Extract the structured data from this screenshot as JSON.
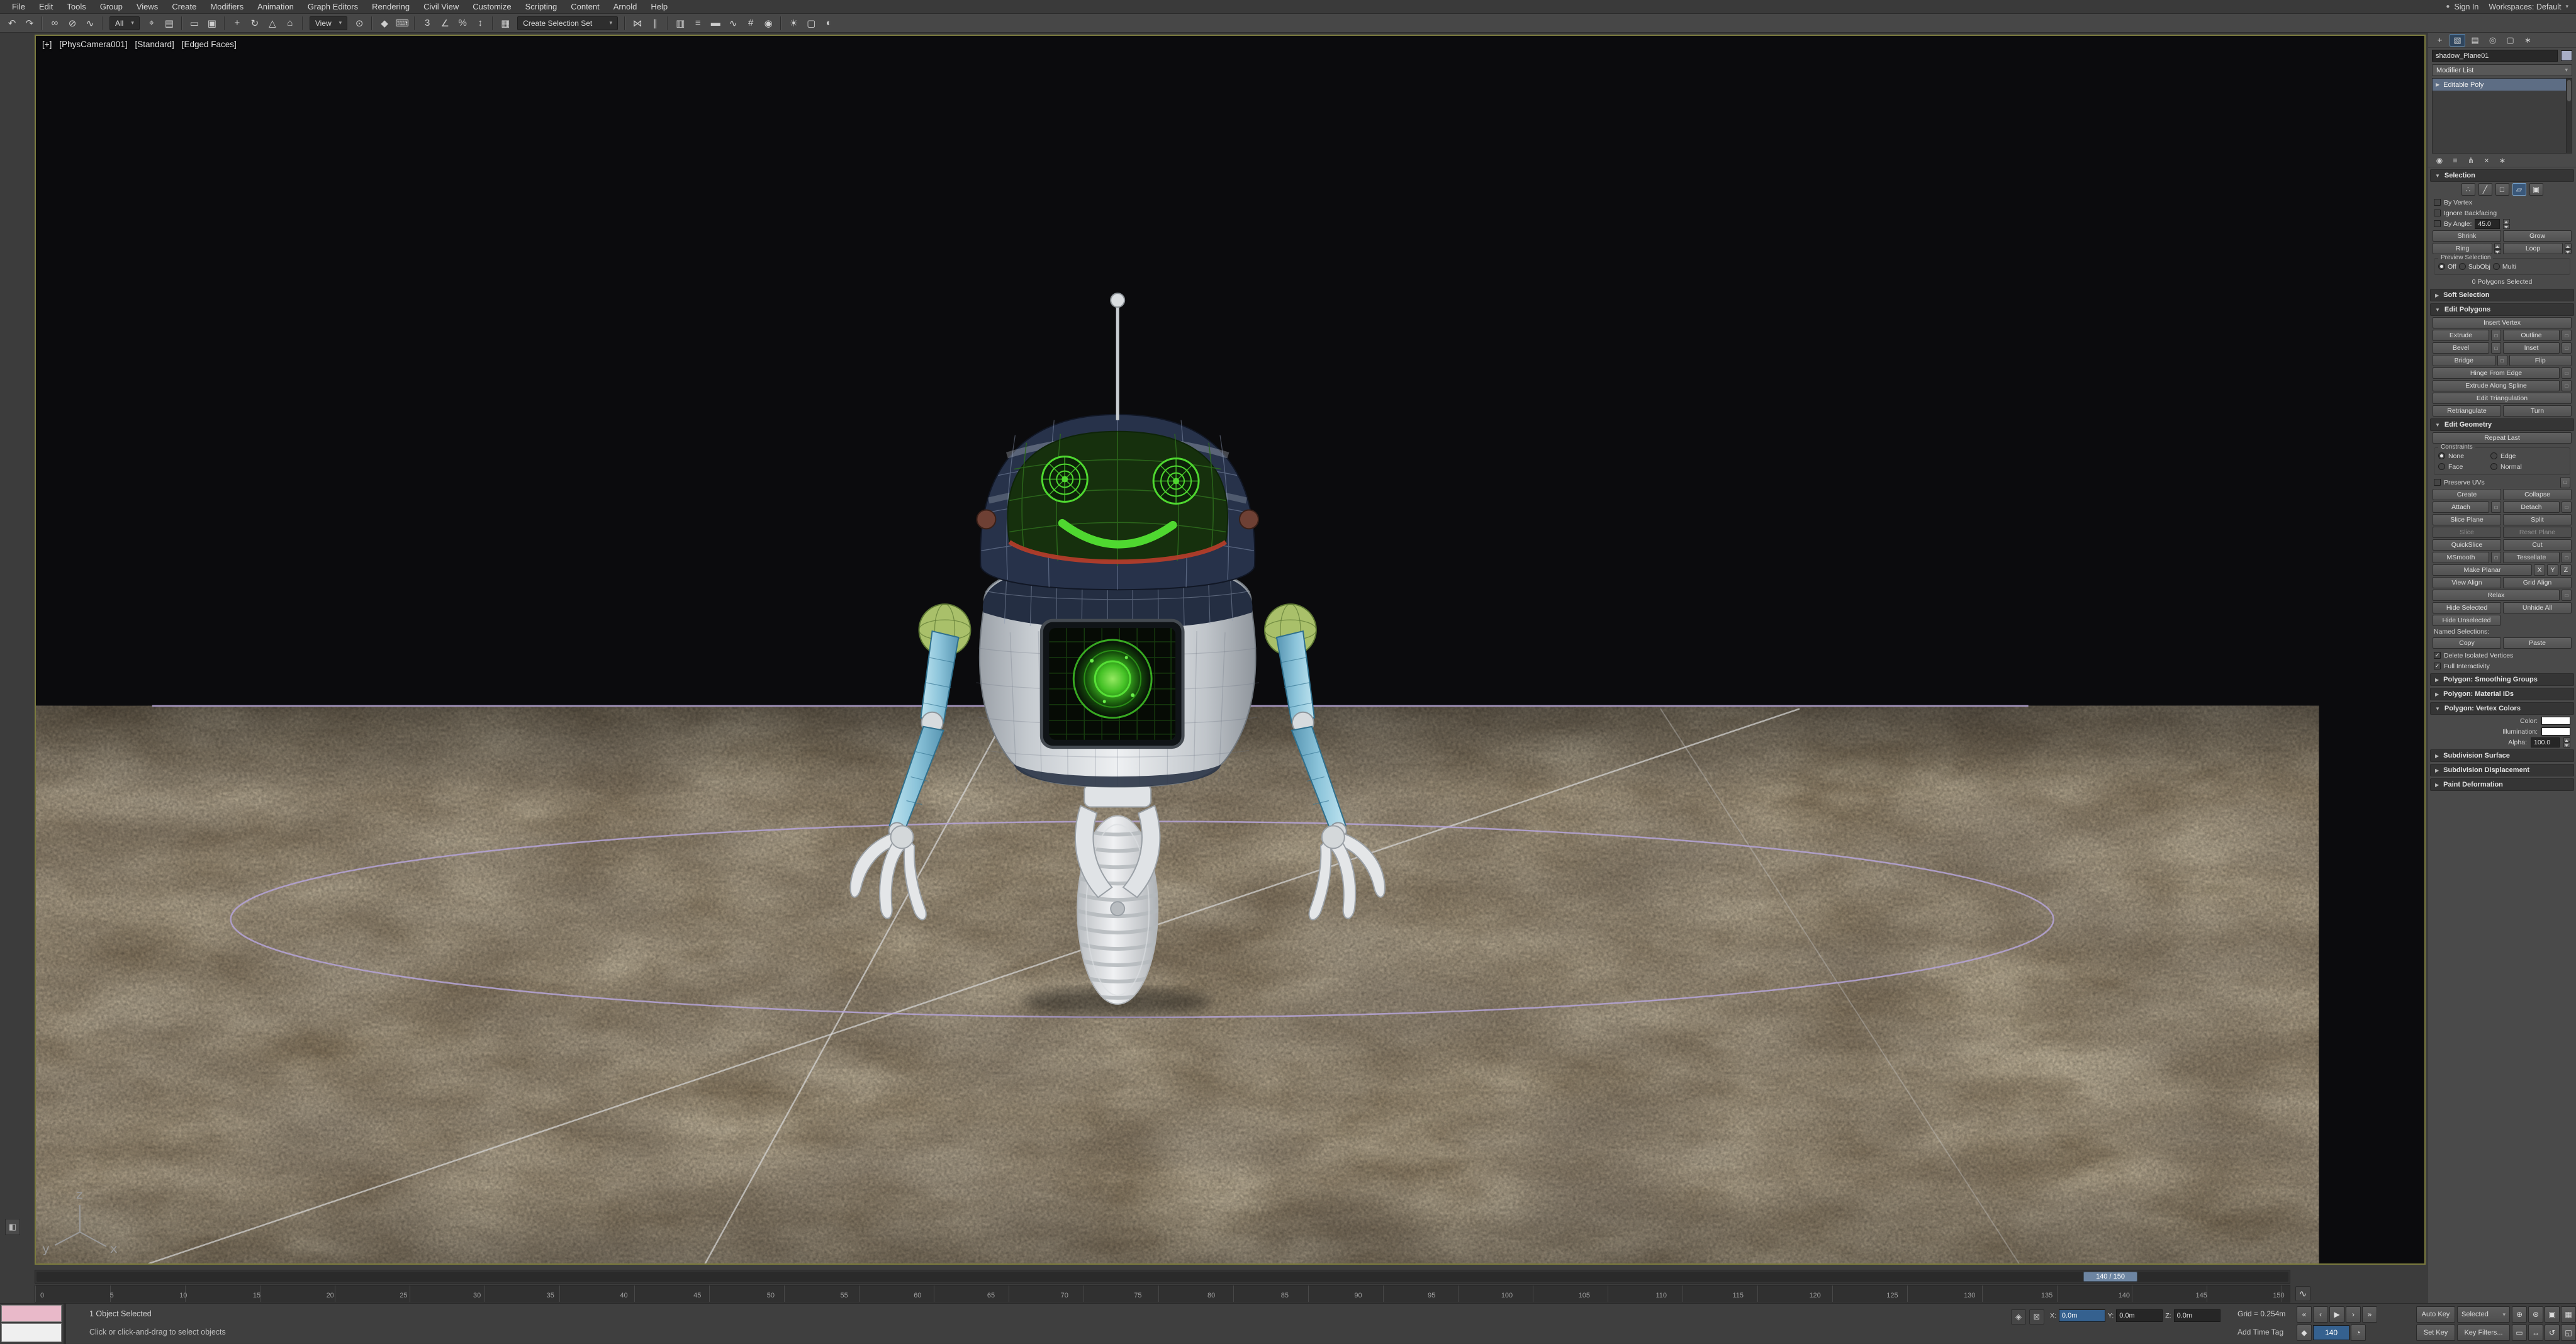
{
  "icons": {
    "check": "✓",
    "chevron_down": "▾",
    "arrow_open": "▼",
    "arrow_closed": "▶",
    "user": "●",
    "settings": "□",
    "curve": "∿",
    "isolate": "◈",
    "lock": "⊠",
    "layout_tab": "◧",
    "key_mode": "◆",
    "time_config": "◔"
  },
  "menubar": {
    "items": [
      "File",
      "Edit",
      "Tools",
      "Group",
      "Views",
      "Create",
      "Modifiers",
      "Animation",
      "Graph Editors",
      "Rendering",
      "Civil View",
      "Customize",
      "Scripting",
      "Content",
      "Arnold",
      "Help"
    ],
    "sign_in": "Sign In",
    "workspace": "Workspaces: Default"
  },
  "toolbar": {
    "icons1": [
      {
        "name": "undo-icon",
        "glyph": "↶"
      },
      {
        "name": "redo-icon",
        "glyph": "↷"
      },
      {
        "name": "toolbar-separator",
        "glyph": ""
      },
      {
        "name": "select-and-link-icon",
        "glyph": "∞"
      },
      {
        "name": "unlink-selection-icon",
        "glyph": "⊘"
      },
      {
        "name": "bind-to-space-warp-icon",
        "glyph": "∿"
      },
      {
        "name": "toolbar-separator",
        "glyph": ""
      }
    ],
    "selection_filter_value": "All",
    "icons2": [
      {
        "name": "select-object-icon",
        "glyph": "⌖"
      },
      {
        "name": "select-by-name-icon",
        "glyph": "▤"
      },
      {
        "name": "toolbar-separator",
        "glyph": ""
      },
      {
        "name": "rectangular-selection-region-icon",
        "glyph": "▭"
      },
      {
        "name": "window-crossing-icon",
        "glyph": "▣"
      },
      {
        "name": "toolbar-separator",
        "glyph": ""
      },
      {
        "name": "select-and-move-icon",
        "glyph": "+"
      },
      {
        "name": "select-and-rotate-icon",
        "glyph": "↻"
      },
      {
        "name": "select-and-scale-icon",
        "glyph": "△"
      },
      {
        "name": "select-and-place-icon",
        "glyph": "⌂"
      },
      {
        "name": "toolbar-separator",
        "glyph": ""
      }
    ],
    "ref_coord_value": "View",
    "icons3": [
      {
        "name": "use-pivot-point-center-icon",
        "glyph": "⊙"
      },
      {
        "name": "toolbar-separator",
        "glyph": ""
      },
      {
        "name": "select-and-manipulate-icon",
        "glyph": "◆"
      },
      {
        "name": "keyboard-shortcut-override-icon",
        "glyph": "⌨"
      },
      {
        "name": "toolbar-separator",
        "glyph": ""
      },
      {
        "name": "snaps-toggle-icon",
        "glyph": "3"
      },
      {
        "name": "angle-snap-icon",
        "glyph": "∠"
      },
      {
        "name": "percent-snap-icon",
        "glyph": "%"
      },
      {
        "name": "spinner-snap-icon",
        "glyph": "↕"
      },
      {
        "name": "toolbar-separator",
        "glyph": ""
      },
      {
        "name": "edit-named-selection-sets-icon",
        "glyph": "▦"
      }
    ],
    "named_sets_value": "Create Selection Set",
    "icons4": [
      {
        "name": "toolbar-separator",
        "glyph": ""
      },
      {
        "name": "mirror-icon",
        "glyph": "⋈"
      },
      {
        "name": "align-icon",
        "glyph": "∥"
      },
      {
        "name": "toolbar-separator",
        "glyph": ""
      },
      {
        "name": "toggle-scene-explorer-icon",
        "glyph": "▥"
      },
      {
        "name": "toggle-layer-explorer-icon",
        "glyph": "≡"
      },
      {
        "name": "toggle-ribbon-icon",
        "glyph": "▬"
      },
      {
        "name": "curve-editor-icon",
        "glyph": "∿"
      },
      {
        "name": "schematic-view-icon",
        "glyph": "#"
      },
      {
        "name": "material-editor-icon",
        "glyph": "◉"
      },
      {
        "name": "toolbar-separator",
        "glyph": ""
      },
      {
        "name": "render-setup-icon",
        "glyph": "☀"
      },
      {
        "name": "rendered-frame-window-icon",
        "glyph": "▢"
      },
      {
        "name": "render-icon",
        "glyph": "◐"
      }
    ]
  },
  "viewport": {
    "label_plus": "[+]",
    "label_camera": "[PhysCamera001]",
    "label_shading": "[Standard]",
    "label_quality": "[Edged Faces]"
  },
  "panel": {
    "tabs": [
      {
        "name": "tab-create",
        "glyph": "+"
      },
      {
        "name": "tab-modify",
        "glyph": "▧"
      },
      {
        "name": "tab-hierarchy",
        "glyph": "▤"
      },
      {
        "name": "tab-motion",
        "glyph": "◎"
      },
      {
        "name": "tab-display",
        "glyph": "▢"
      },
      {
        "name": "tab-utilities",
        "glyph": "∗"
      }
    ],
    "object_name": "shadow_Plane01",
    "modifier_list": "Modifier List",
    "stack_item": "Editable Poly",
    "stack_tools": [
      {
        "name": "pin-stack-icon",
        "glyph": "◉"
      },
      {
        "name": "show-end-result-icon",
        "glyph": "≡"
      },
      {
        "name": "make-unique-icon",
        "glyph": "⋔"
      },
      {
        "name": "remove-modifier-icon",
        "glyph": "×"
      },
      {
        "name": "configure-modifier-sets-icon",
        "glyph": "∗"
      }
    ],
    "selection": {
      "title": "Selection",
      "so_icons": [
        {
          "name": "subobject-vertex-icon",
          "glyph": "∴"
        },
        {
          "name": "subobject-edge-icon",
          "glyph": "╱"
        },
        {
          "name": "subobject-border-icon",
          "glyph": "□"
        },
        {
          "name": "subobject-polygon-icon",
          "glyph": "▱"
        },
        {
          "name": "subobject-element-icon",
          "glyph": "▣"
        }
      ],
      "by_vertex": "By Vertex",
      "ignore_backfacing": "Ignore Backfacing",
      "by_angle": "By Angle:",
      "by_angle_value": "45.0",
      "shrink": "Shrink",
      "grow": "Grow",
      "ring": "Ring",
      "loop": "Loop",
      "preview_title": "Preview Selection",
      "preview_off": "Off",
      "preview_subobj": "SubObj",
      "preview_multi": "Multi",
      "status": "0 Polygons Selected"
    },
    "soft_selection_title": "Soft Selection",
    "edit_polygons": {
      "title": "Edit Polygons",
      "insert_vertex": "Insert Vertex",
      "extrude": "Extrude",
      "outline": "Outline",
      "bevel": "Bevel",
      "inset": "Inset",
      "bridge": "Bridge",
      "flip": "Flip",
      "hinge": "Hinge From Edge",
      "extrude_spline": "Extrude Along Spline",
      "edit_triangulation": "Edit Triangulation",
      "retriangulate": "Retriangulate",
      "turn": "Turn"
    },
    "edit_geometry": {
      "title": "Edit Geometry",
      "repeat_last": "Repeat Last",
      "constraints_title": "Constraints",
      "c_none": "None",
      "c_edge": "Edge",
      "c_face": "Face",
      "c_normal": "Normal",
      "preserve_uvs": "Preserve UVs",
      "create": "Create",
      "collapse": "Collapse",
      "attach": "Attach",
      "detach": "Detach",
      "slice_plane": "Slice Plane",
      "split": "Split",
      "slice": "Slice",
      "reset_plane": "Reset Plane",
      "quickslice": "QuickSlice",
      "cut": "Cut",
      "msmooth": "MSmooth",
      "tessellate": "Tessellate",
      "make_planar": "Make Planar",
      "ax_x": "X",
      "ax_y": "Y",
      "ax_z": "Z",
      "view_align": "View Align",
      "grid_align": "Grid Align",
      "relax": "Relax",
      "hide_selected": "Hide Selected",
      "unhide_all": "Unhide All",
      "hide_unselected": "Hide Unselected",
      "named_selections": "Named Selections:",
      "copy": "Copy",
      "paste": "Paste",
      "delete_isolated": "Delete Isolated Vertices",
      "full_interactivity": "Full Interactivity"
    },
    "smoothing_title": "Polygon: Smoothing Groups",
    "material_ids_title": "Polygon: Material IDs",
    "vertex_colors": {
      "title": "Polygon: Vertex Colors",
      "color": "Color:",
      "illumination": "Illumination:",
      "alpha": "Alpha:",
      "alpha_value": "100.0"
    },
    "subdiv_surface_title": "Subdivision Surface",
    "subdiv_disp_title": "Subdivision Displacement",
    "paint_def_title": "Paint Deformation"
  },
  "trackbar": {
    "ticks": [
      "0",
      "5",
      "10",
      "15",
      "20",
      "25",
      "30",
      "35",
      "40",
      "45",
      "50",
      "55",
      "60",
      "65",
      "70",
      "75",
      "80",
      "85",
      "90",
      "95",
      "100",
      "105",
      "110",
      "115",
      "120",
      "125",
      "130",
      "135",
      "140",
      "145",
      "150"
    ],
    "slider_label": "140 / 150"
  },
  "statusbar": {
    "selection_status": "1 Object Selected",
    "prompt": "Click or click-and-drag to select objects",
    "x_label": "X:",
    "x_value": "0.0m",
    "y_label": "Y:",
    "y_value": "0.0m",
    "z_label": "Z:",
    "z_value": "0.0m",
    "grid_info": "Grid = 0.254m",
    "add_time_tag": "Add Time Tag",
    "auto_key": "Auto Key",
    "selected_mode": "Selected",
    "set_key": "Set Key",
    "key_filters": "Key Filters...",
    "frame": "140",
    "playback_icons": [
      {
        "name": "go-to-start-icon",
        "glyph": "«"
      },
      {
        "name": "previous-frame-icon",
        "glyph": "‹"
      },
      {
        "name": "play-icon",
        "glyph": "▶"
      },
      {
        "name": "next-frame-icon",
        "glyph": "›"
      },
      {
        "name": "go-to-end-icon",
        "glyph": "»"
      }
    ],
    "nav_icons_row1": [
      {
        "name": "zoom-icon",
        "glyph": "⊕"
      },
      {
        "name": "zoom-all-icon",
        "glyph": "⊛"
      },
      {
        "name": "zoom-extents-icon",
        "glyph": "▣"
      },
      {
        "name": "zoom-extents-all-icon",
        "glyph": "▦"
      }
    ],
    "nav_icons_row2": [
      {
        "name": "field-of-view-icon",
        "glyph": "▭"
      },
      {
        "name": "pan-icon",
        "glyph": "↔"
      },
      {
        "name": "orbit-icon",
        "glyph": "↺"
      },
      {
        "name": "maximize-viewport-icon",
        "glyph": "◱"
      }
    ]
  }
}
